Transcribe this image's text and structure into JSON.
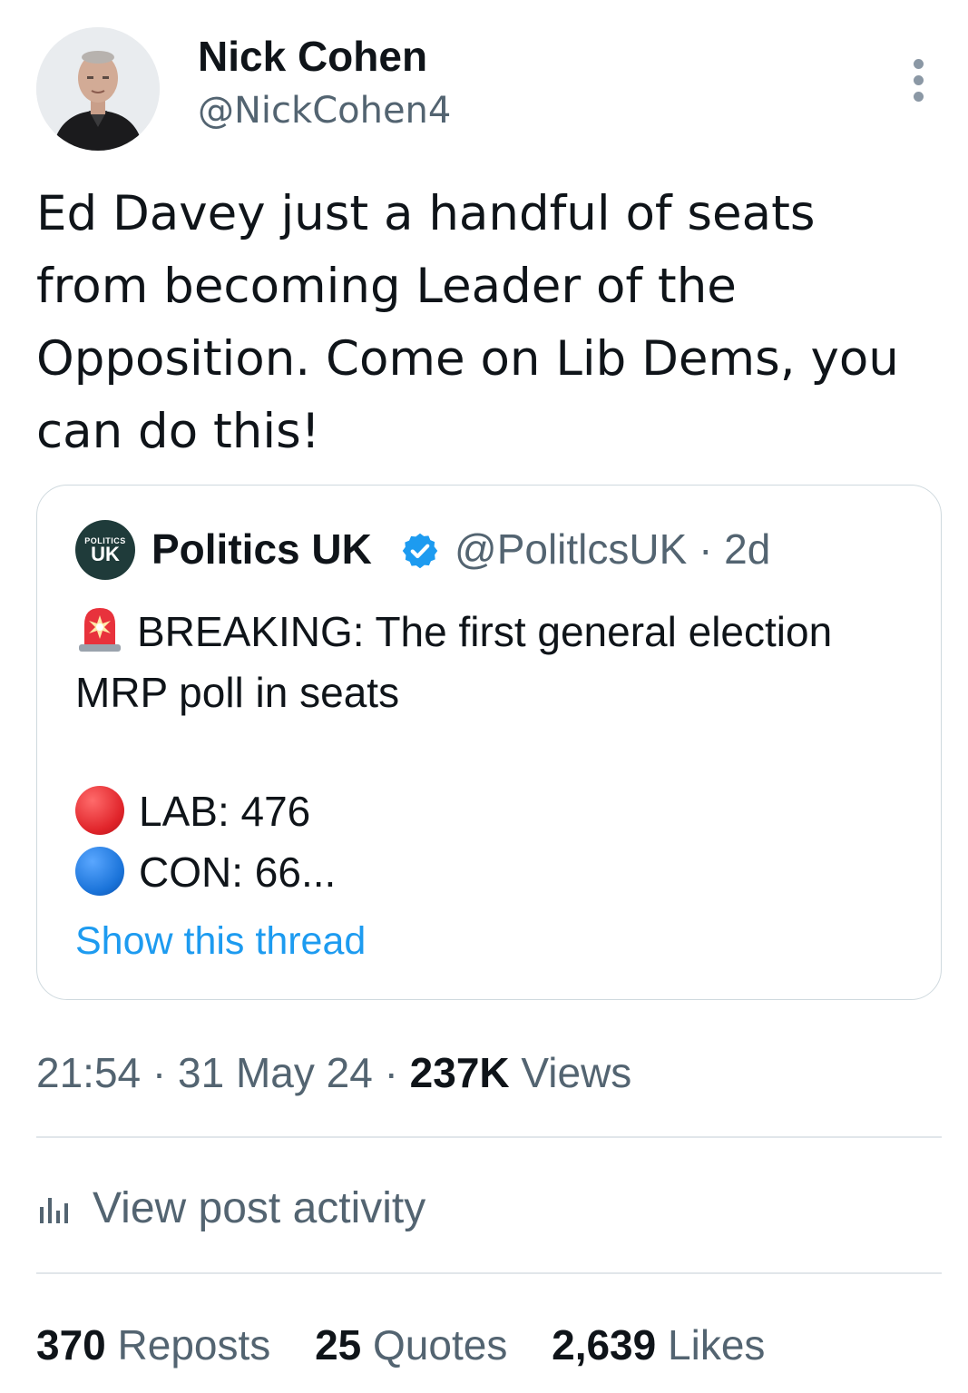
{
  "author": {
    "name": "Nick Cohen",
    "handle": "@NickCohen4"
  },
  "tweet": {
    "text": "Ed Davey just a handful of seats from becoming Leader of the Opposition. Come on Lib Dems, you can do this!"
  },
  "quoted": {
    "avatar_small": "POLITICS",
    "avatar_big": "UK",
    "name": "Politics UK",
    "handle_time": "@PolitlcsUK · 2d",
    "line1": "BREAKING: The first general election MRP poll in seats",
    "lab": "LAB: 476",
    "con": "CON: 66...",
    "show_thread": "Show this thread"
  },
  "meta": {
    "time_date": "21:54 · 31 May 24 · ",
    "views_count": "237K",
    "views_label": " Views"
  },
  "activity": {
    "label": "View post activity"
  },
  "stats": {
    "reposts_count": "370",
    "reposts_label": " Reposts",
    "quotes_count": "25",
    "quotes_label": " Quotes",
    "likes_count": "2,639",
    "likes_label": " Likes"
  },
  "colors": {
    "accent": "#1d9bf0",
    "muted": "#536471",
    "lab_red": "#e0242a",
    "con_blue": "#1a73d9"
  },
  "icons": [
    "more-vertical-icon",
    "verified-badge-icon",
    "siren-emoji-icon",
    "red-circle-icon",
    "blue-circle-icon",
    "bar-chart-icon"
  ]
}
